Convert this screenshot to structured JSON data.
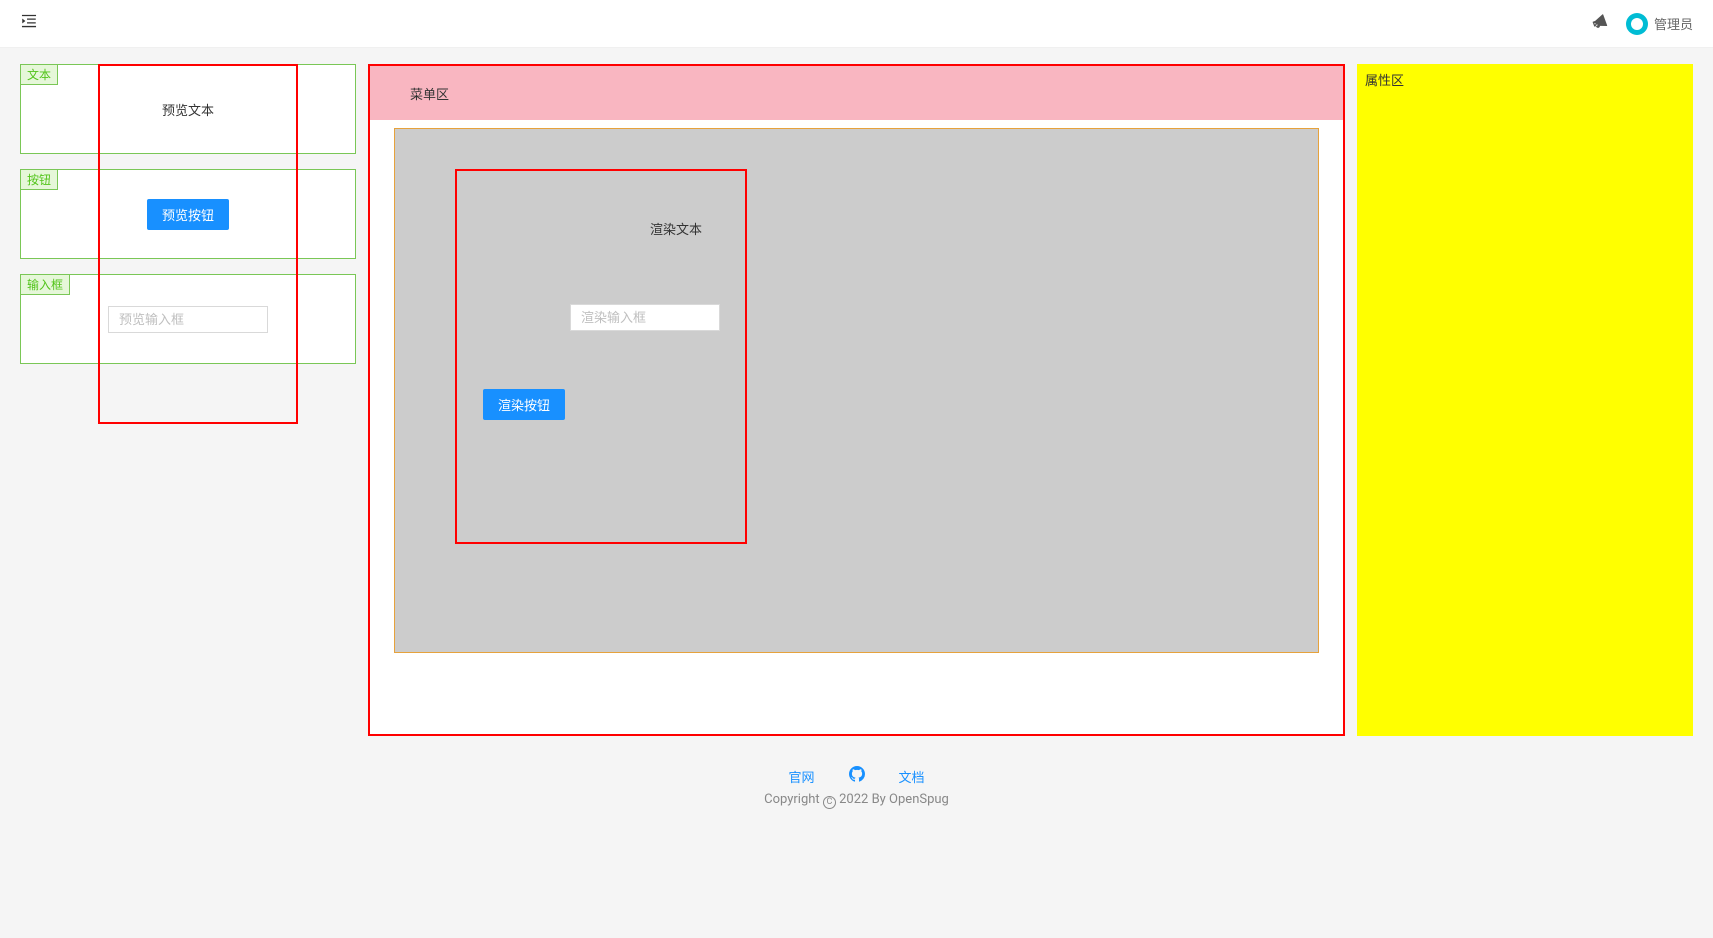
{
  "header": {
    "user_name": "管理员"
  },
  "palette": {
    "items": [
      {
        "tag": "文本",
        "preview_text": "预览文本"
      },
      {
        "tag": "按钮",
        "button_label": "预览按钮"
      },
      {
        "tag": "输入框",
        "input_placeholder": "预览输入框"
      }
    ]
  },
  "editor": {
    "menu_label": "菜单区",
    "canvas": {
      "render_text": "渲染文本",
      "render_input_placeholder": "渲染输入框",
      "render_button_label": "渲染按钮"
    }
  },
  "props": {
    "title": "属性区"
  },
  "footer": {
    "link_site": "官网",
    "link_docs": "文档",
    "copyright": "Copyright   2022 By OpenSpug",
    "copyright_symbol": "C"
  }
}
